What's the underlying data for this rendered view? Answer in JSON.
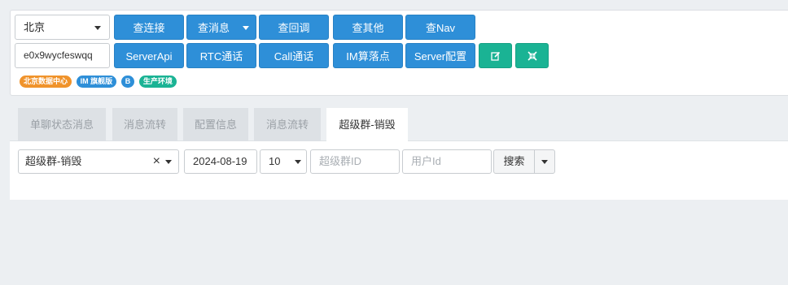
{
  "top": {
    "region_select": "北京",
    "id_input": "e0x9wycfeswqq",
    "row1_buttons": [
      "查连接",
      "查消息",
      "查回调",
      "查其他",
      "查Nav"
    ],
    "row2_buttons": [
      "ServerApi",
      "RTC通话",
      "Call通话",
      "IM算落点",
      "Server配置"
    ],
    "edit_icon": "edit-icon",
    "resize_icon": "compress-icon",
    "badges": [
      "北京数据中心",
      "IM 旗舰版",
      "B",
      "生产环境"
    ]
  },
  "tabs": [
    "单聊状态消息",
    "消息流转",
    "配置信息",
    "消息流转",
    "超级群-销毁"
  ],
  "filters": {
    "type_select": "超级群-销毁",
    "date": "2024-08-19",
    "count": "10",
    "group_id_placeholder": "超级群ID",
    "user_id_placeholder": "用户Id",
    "search_label": "搜索"
  },
  "colors": {
    "primary": "#2e8fd8",
    "success": "#1ab394",
    "warning": "#f0932b",
    "background": "#eceff2"
  }
}
